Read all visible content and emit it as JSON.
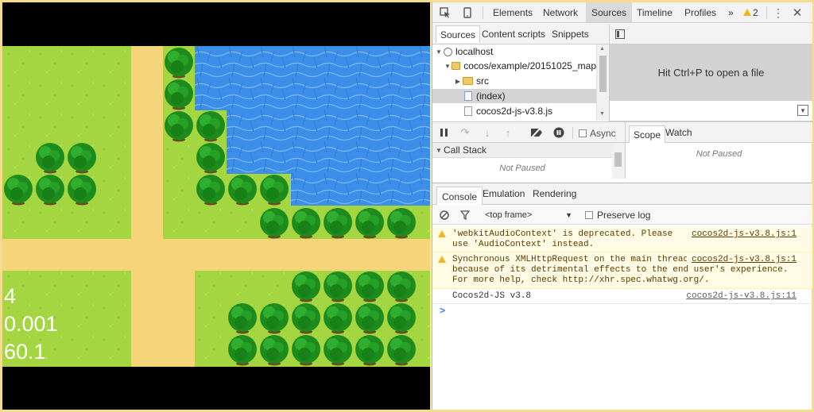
{
  "game": {
    "stat_objects": "4",
    "stat_delta": "0.001",
    "stat_fps": "60.1"
  },
  "toolbar": {
    "tabs": [
      "Elements",
      "Network",
      "Sources",
      "Timeline",
      "Profiles"
    ],
    "more_label": "»",
    "warning_count": "2"
  },
  "navigator": {
    "tabs": [
      "Sources",
      "Content scripts",
      "Snippets"
    ],
    "tree": [
      {
        "label": "localhost"
      },
      {
        "label": "cocos/example/20151025_map"
      },
      {
        "label": "src"
      },
      {
        "label": "(index)"
      },
      {
        "label": "cocos2d-js-v3.8.js"
      }
    ]
  },
  "editor": {
    "hint": "Hit Ctrl+P to open a file"
  },
  "debugger": {
    "async_label": "Async",
    "scope_tabs": [
      "Scope",
      "Watch"
    ],
    "not_paused": "Not Paused",
    "call_stack_label": "Call Stack",
    "call_stack_status": "Not Paused"
  },
  "drawer": {
    "tabs": [
      "Console",
      "Emulation",
      "Rendering"
    ],
    "frame_select": "<top frame>",
    "preserve_log": "Preserve log"
  },
  "console": {
    "messages": [
      {
        "level": "warning",
        "text": "'webkitAudioContext' is deprecated. Please use 'AudioContext' instead.",
        "source": "cocos2d-js-v3.8.js:1"
      },
      {
        "level": "warning",
        "text": "Synchronous XMLHttpRequest on the main thread is deprecated because of its detrimental effects to the end user's experience. For more help, check http://xhr.spec.whatwg.org/.",
        "source": "cocos2d-js-v3.8.js:1"
      },
      {
        "level": "log",
        "text": "Cocos2d-JS v3.8",
        "source": "cocos2d-js-v3.8.js:11"
      }
    ],
    "prompt": ">"
  },
  "colors": {
    "grass": "#9bd13a",
    "sand": "#f5d47a",
    "water": "#3a8fe8",
    "tree": "#1f8f1f"
  }
}
